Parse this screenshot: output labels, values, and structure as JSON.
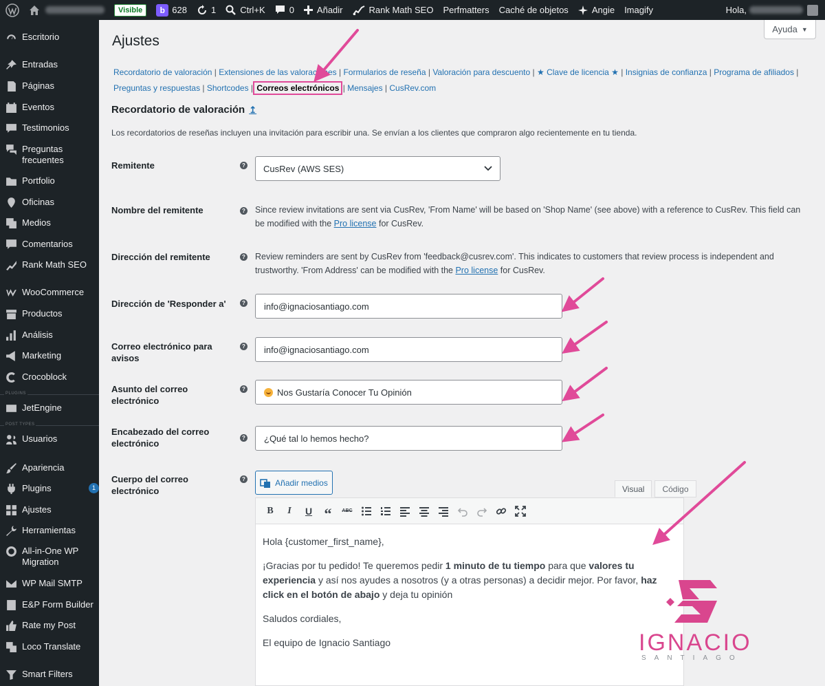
{
  "adminbar": {
    "visible_badge": "Visible",
    "bb_count": "628",
    "updates_count": "1",
    "search_shortcut": "Ctrl+K",
    "comments_count": "0",
    "add_new": "Añadir",
    "rank_math": "Rank Math SEO",
    "perfmatters": "Perfmatters",
    "object_cache": "Caché de objetos",
    "angie": "Angie",
    "imagify": "Imagify",
    "greeting": "Hola,"
  },
  "sidebar": {
    "items": [
      {
        "label": "Escritorio",
        "icon": "dashboard-icon"
      },
      {
        "label": "Entradas",
        "icon": "pin-icon"
      },
      {
        "label": "Páginas",
        "icon": "pages-icon"
      },
      {
        "label": "Eventos",
        "icon": "calendar-icon"
      },
      {
        "label": "Testimonios",
        "icon": "quote-icon"
      },
      {
        "label": "Preguntas frecuentes",
        "icon": "faq-icon"
      },
      {
        "label": "Portfolio",
        "icon": "folder-icon"
      },
      {
        "label": "Oficinas",
        "icon": "location-icon"
      },
      {
        "label": "Medios",
        "icon": "media-icon"
      },
      {
        "label": "Comentarios",
        "icon": "comment-icon"
      },
      {
        "label": "Rank Math SEO",
        "icon": "rankmath-icon"
      },
      {
        "label": "WooCommerce",
        "icon": "woo-icon"
      },
      {
        "label": "Productos",
        "icon": "archive-icon"
      },
      {
        "label": "Análisis",
        "icon": "bar-chart-icon"
      },
      {
        "label": "Marketing",
        "icon": "megaphone-icon"
      },
      {
        "label": "Crocoblock",
        "icon": "crocoblock-icon"
      },
      {
        "label": "JetEngine",
        "icon": "jetengine-icon"
      },
      {
        "label": "Usuarios",
        "icon": "users-icon"
      },
      {
        "label": "Apariencia",
        "icon": "brush-icon"
      },
      {
        "label": "Plugins",
        "icon": "plug-icon",
        "badge": "1"
      },
      {
        "label": "Ajustes",
        "icon": "settings-icon"
      },
      {
        "label": "Herramientas",
        "icon": "wrench-icon"
      },
      {
        "label": "All-in-One WP Migration",
        "icon": "migration-icon"
      },
      {
        "label": "WP Mail SMTP",
        "icon": "mail-icon"
      },
      {
        "label": "E&P Form Builder",
        "icon": "form-icon"
      },
      {
        "label": "Rate my Post",
        "icon": "thumbs-up-icon"
      },
      {
        "label": "Loco Translate",
        "icon": "translate-icon"
      },
      {
        "label": "Smart Filters",
        "icon": "filter-icon"
      }
    ],
    "separators": [
      "PLUGINS",
      "POST TYPES"
    ]
  },
  "main": {
    "help_label": "Ayuda",
    "title": "Ajustes",
    "subnav": [
      "Recordatorio de valoración",
      "Extensiones de las valoraciones",
      "Formularios de reseña",
      "Valoración para descuento",
      "★ Clave de licencia ★",
      "Insignias de confianza",
      "Programa de afiliados",
      "Preguntas y respuestas",
      "Shortcodes",
      "Correos electrónicos",
      "Mensajes",
      "CusRev.com"
    ],
    "section_title": "Recordatorio de valoración",
    "section_desc": "Los recordatorios de reseñas incluyen una invitación para escribir una. Se envían a los clientes que compraron algo recientemente en tu tienda.",
    "fields": {
      "sender_label": "Remitente",
      "sender_value": "CusRev (AWS SES)",
      "sender_name_label": "Nombre del remitente",
      "sender_name_desc_pre": "Since review invitations are sent via CusRev, 'From Name' will be based on 'Shop Name' (see above) with a reference to CusRev. This field can be modified with the ",
      "sender_name_link": "Pro license",
      "sender_name_desc_post": " for CusRev.",
      "sender_address_label": "Dirección del remitente",
      "sender_address_desc_pre": "Review reminders are sent by CusRev from 'feedback@cusrev.com'. This indicates to customers that review process is independent and trustworthy. 'From Address' can be modified with the ",
      "sender_address_link": "Pro license",
      "sender_address_desc_post": " for CusRev.",
      "reply_to_label": "Dirección de 'Responder a'",
      "reply_to_value": "info@ignaciosantiago.com",
      "notify_label": "Correo electrónico para avisos",
      "notify_value": "info@ignaciosantiago.com",
      "subject_label": "Asunto del correo electrónico",
      "subject_value": "Nos Gustaría Conocer Tu Opinión",
      "heading_label": "Encabezado del correo electrónico",
      "heading_value": "¿Qué tal lo hemos hecho?",
      "body_label": "Cuerpo del correo electrónico"
    },
    "editor": {
      "add_media": "Añadir medios",
      "tab_visual": "Visual",
      "tab_code": "Código",
      "greeting": "Hola {customer_first_name},",
      "p2_a": "¡Gracias por tu pedido! Te queremos pedir ",
      "p2_b": "1 minuto de tu tiempo",
      "p2_c": " para que ",
      "p2_d": "valores tu experiencia",
      "p2_e": " y así nos ayudes a nosotros (y a otras personas) a decidir mejor. Por favor, ",
      "p2_f": "haz click en el botón de abajo",
      "p2_g": " y deja tu opinión",
      "closing": "Saludos cordiales,",
      "signature": "El equipo de Ignacio Santiago"
    },
    "watermark": {
      "name": "IGNACIO",
      "surname": "SANTIAGO"
    }
  },
  "colors": {
    "accent": "#2271b1",
    "annotation": "#e04a99",
    "admin_bg": "#1d2327"
  }
}
